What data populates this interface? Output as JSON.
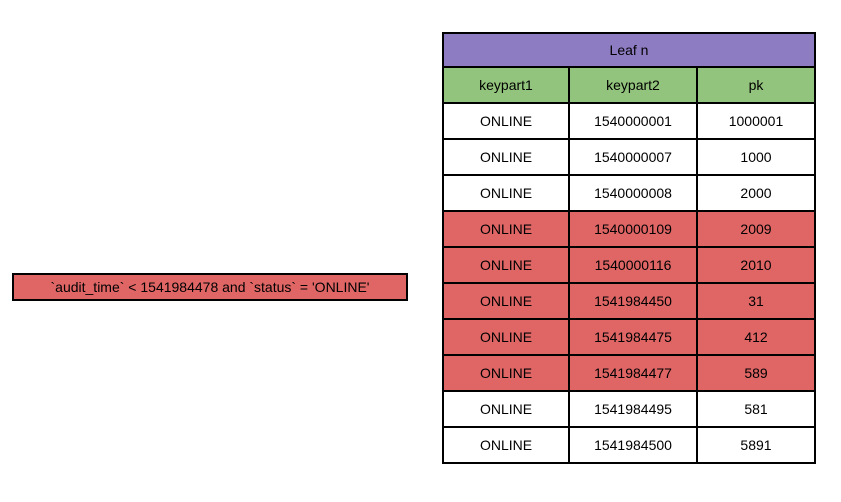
{
  "query": {
    "text": "`audit_time` < 1541984478 and `status` = 'ONLINE'"
  },
  "table": {
    "title": "Leaf n",
    "headers": {
      "c1": "keypart1",
      "c2": "keypart2",
      "c3": "pk"
    },
    "rows": [
      {
        "hl": false,
        "c1": "ONLINE",
        "c2": "1540000001",
        "c3": "1000001"
      },
      {
        "hl": false,
        "c1": "ONLINE",
        "c2": "1540000007",
        "c3": "1000"
      },
      {
        "hl": false,
        "c1": "ONLINE",
        "c2": "1540000008",
        "c3": "2000"
      },
      {
        "hl": true,
        "c1": "ONLINE",
        "c2": "1540000109",
        "c3": "2009"
      },
      {
        "hl": true,
        "c1": "ONLINE",
        "c2": "1540000116",
        "c3": "2010"
      },
      {
        "hl": true,
        "c1": "ONLINE",
        "c2": "1541984450",
        "c3": "31"
      },
      {
        "hl": true,
        "c1": "ONLINE",
        "c2": "1541984475",
        "c3": "412"
      },
      {
        "hl": true,
        "c1": "ONLINE",
        "c2": "1541984477",
        "c3": "589"
      },
      {
        "hl": false,
        "c1": "ONLINE",
        "c2": "1541984495",
        "c3": "581"
      },
      {
        "hl": false,
        "c1": "ONLINE",
        "c2": "1541984500",
        "c3": "5891"
      }
    ]
  },
  "colors": {
    "purple": "#8e7cc3",
    "green": "#93c47d",
    "red": "#e06666"
  }
}
